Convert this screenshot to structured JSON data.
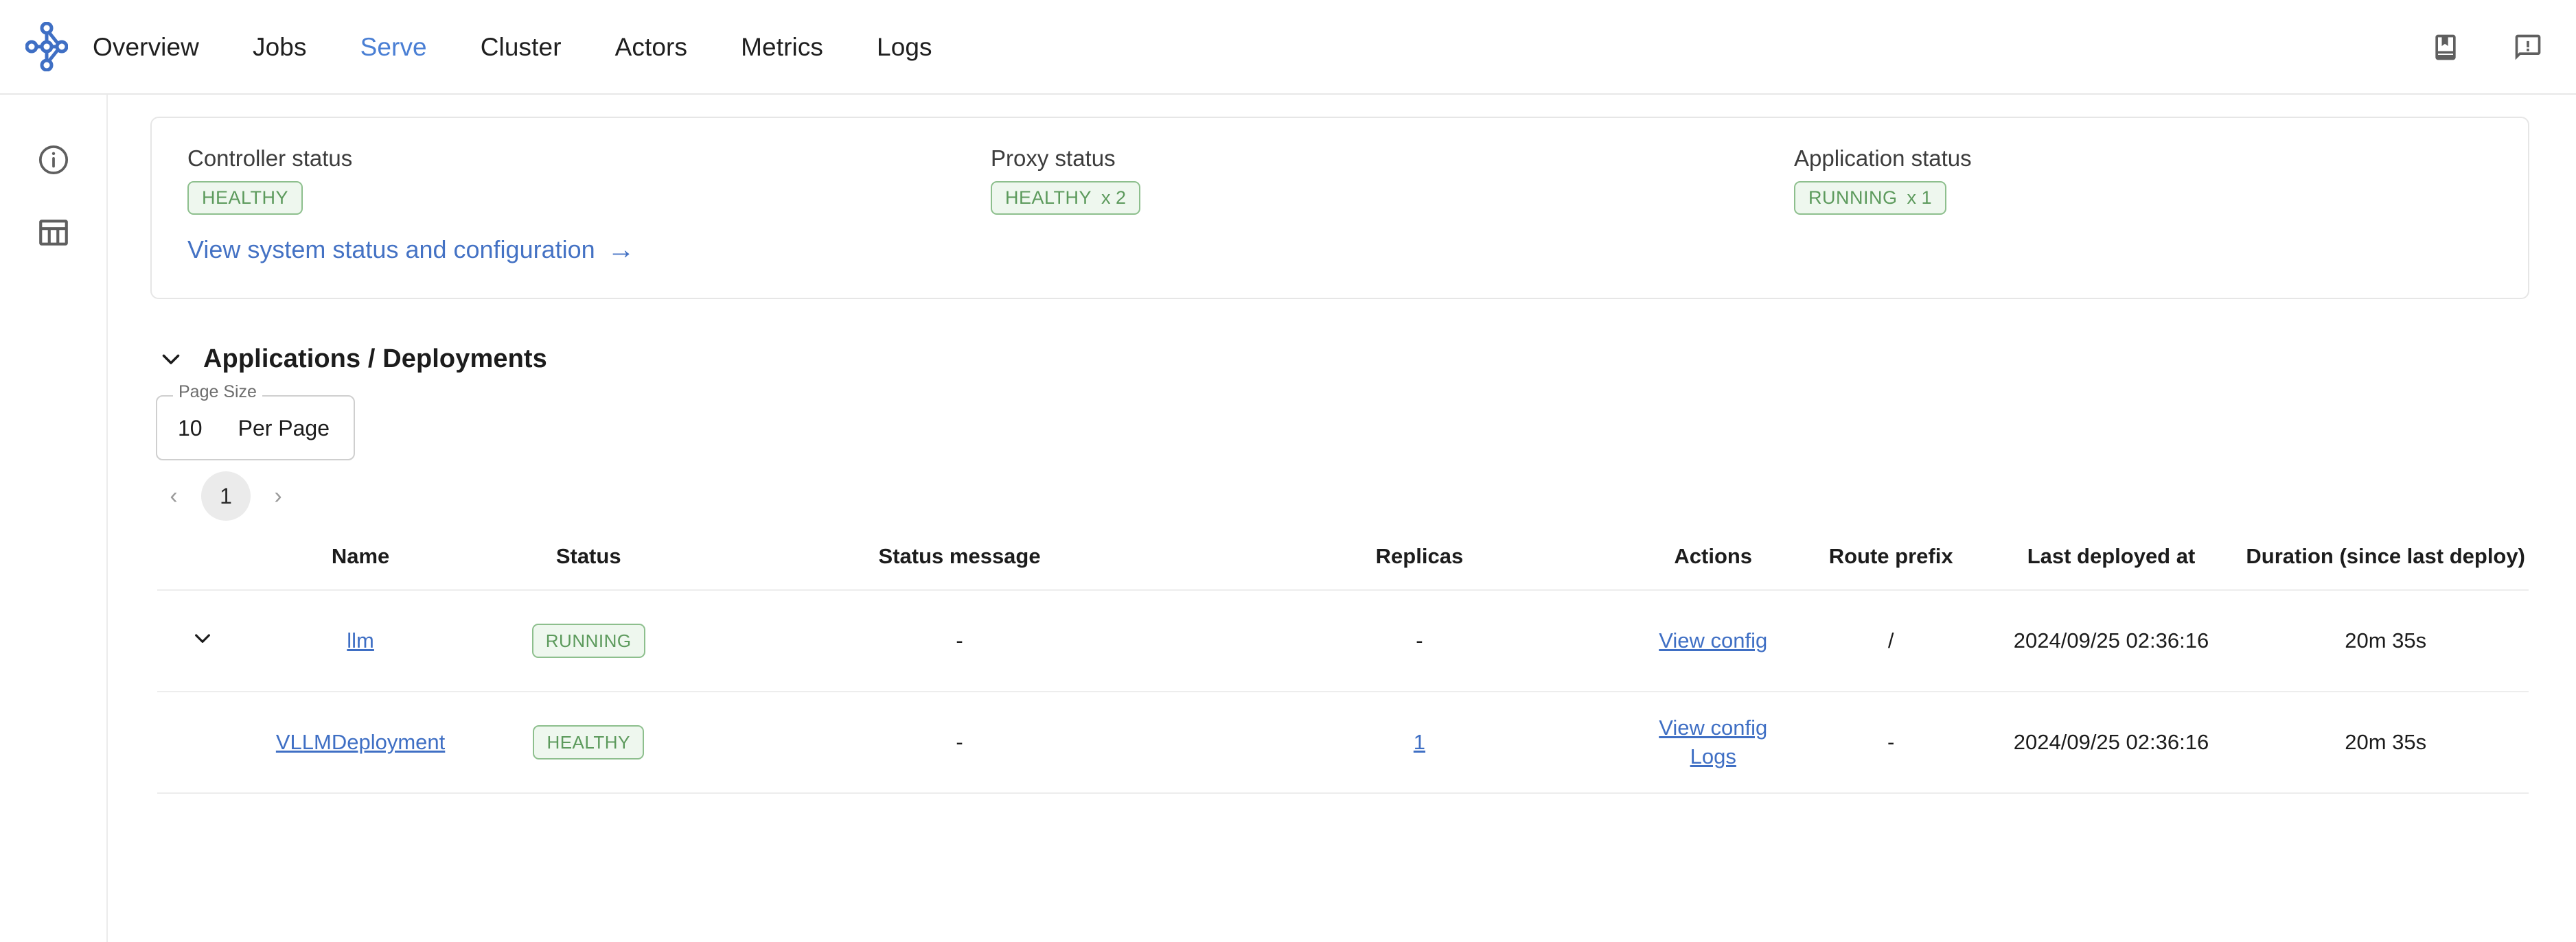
{
  "topnav": {
    "logo_name": "ray-logo",
    "tabs": [
      {
        "label": "Overview",
        "active": false
      },
      {
        "label": "Jobs",
        "active": false
      },
      {
        "label": "Serve",
        "active": true
      },
      {
        "label": "Cluster",
        "active": false
      },
      {
        "label": "Actors",
        "active": false
      },
      {
        "label": "Metrics",
        "active": false
      },
      {
        "label": "Logs",
        "active": false
      }
    ],
    "right_icons": [
      {
        "name": "documentation-book-icon"
      },
      {
        "name": "feedback-alert-icon"
      }
    ]
  },
  "left_rail": {
    "items": [
      {
        "name": "info-icon"
      },
      {
        "name": "table-view-icon"
      }
    ]
  },
  "status_card": {
    "controller": {
      "label": "Controller status",
      "badge": "HEALTHY",
      "multiplier": ""
    },
    "proxy": {
      "label": "Proxy status",
      "badge": "HEALTHY",
      "multiplier": "x 2"
    },
    "application": {
      "label": "Application status",
      "badge": "RUNNING",
      "multiplier": "x 1"
    },
    "system_link": "View system status and configuration",
    "system_link_arrow": "→"
  },
  "applications": {
    "title": "Applications / Deployments",
    "collapse_icon": "chevron-down-icon",
    "page_size": {
      "legend": "Page Size",
      "value": "10",
      "unit": "Per Page"
    },
    "pagination": {
      "prev": "‹",
      "current": "1",
      "next": "›"
    },
    "table": {
      "columns": [
        "",
        "Name",
        "Status",
        "Status message",
        "Replicas",
        "Actions",
        "Route prefix",
        "Last deployed at",
        "Duration (since last deploy)"
      ],
      "rows": [
        {
          "expandable": true,
          "name": "llm",
          "name_is_link": true,
          "status": "RUNNING",
          "status_message": "-",
          "replicas": "-",
          "replicas_is_link": false,
          "actions": [
            "View config"
          ],
          "route_prefix": "/",
          "last_deployed_at": "2024/09/25 02:36:16",
          "duration": "20m 35s"
        },
        {
          "expandable": false,
          "name": "VLLMDeployment",
          "name_is_link": true,
          "status": "HEALTHY",
          "status_message": "-",
          "replicas": "1",
          "replicas_is_link": true,
          "actions": [
            "View config",
            "Logs"
          ],
          "route_prefix": "-",
          "last_deployed_at": "2024/09/25 02:36:16",
          "duration": "20m 35s"
        }
      ]
    }
  },
  "colors": {
    "accent_blue": "#4a7fd4",
    "link_blue": "#3f6fc4",
    "badge_green_text": "#5c9a5c",
    "badge_green_bg": "#eef7ee",
    "badge_green_border": "#8dbf8d",
    "border_grey": "#e6e6e6"
  }
}
